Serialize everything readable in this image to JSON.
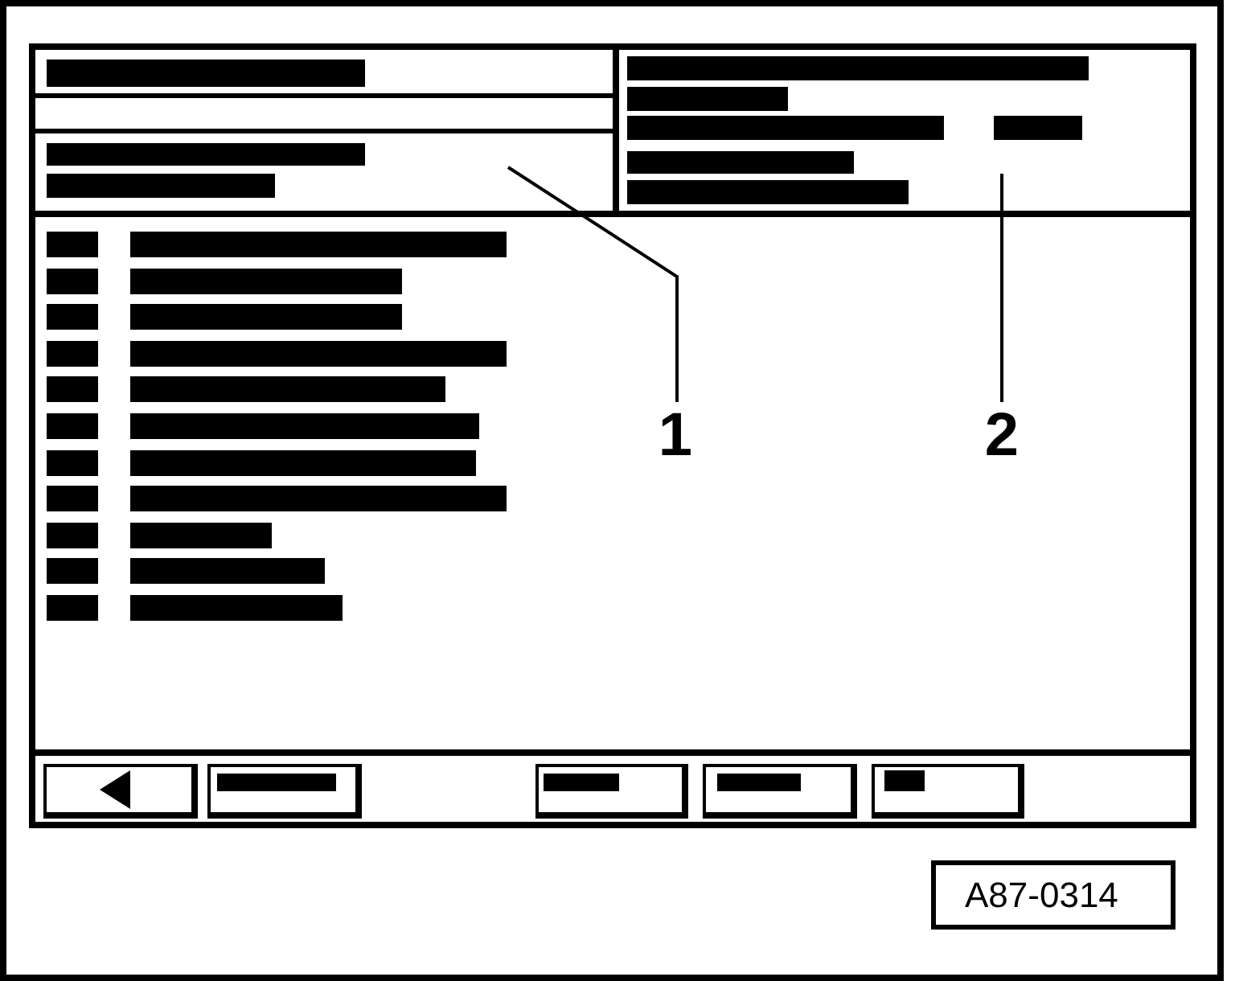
{
  "callouts": [
    {
      "label": "1"
    },
    {
      "label": "2"
    }
  ],
  "figure_id": "A87-0314"
}
